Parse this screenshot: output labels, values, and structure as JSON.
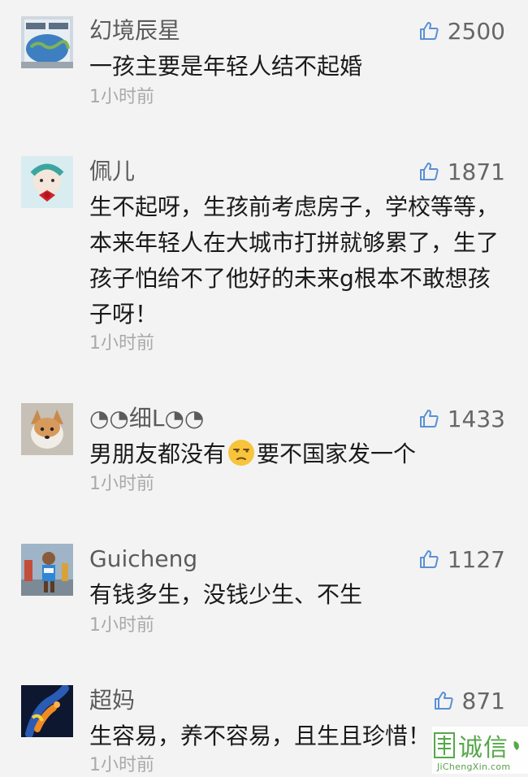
{
  "comments": [
    {
      "username": "幻境辰星",
      "likes": "2500",
      "text": "一孩主要是年轻人结不起婚",
      "time": "1小时前"
    },
    {
      "username": "佩儿",
      "likes": "1871",
      "text": "生不起呀，生孩前考虑房子，学校等等，本来年轻人在大城市打拼就够累了，生了孩子怕给不了他好的未来g根本不敢想孩子呀！",
      "time": "1小时前"
    },
    {
      "username": "◔◔细L◔◔",
      "likes": "1433",
      "text_before": "男朋友都没有",
      "emoji": "unamused-face-emoji",
      "text_after": "要不国家发一个",
      "time": "1小时前"
    },
    {
      "username": "Guicheng",
      "likes": "1127",
      "text": "有钱多生，没钱少生、不生",
      "time": "1小时前"
    },
    {
      "username": "超妈",
      "likes": "871",
      "text": "生容易，养不容易，且生且珍惜！",
      "time": "1小时前"
    }
  ],
  "icons": {
    "like": "thumbs-up-icon"
  },
  "watermark": {
    "chars": "诚信",
    "domain": "JiChengXin.com"
  },
  "colors": {
    "background": "#f3f3f3",
    "username": "#5b5b5b",
    "text": "#1a1a1a",
    "time": "#a9a9a9",
    "thumb": "#5a8fd6",
    "watermark": "#55a84a"
  }
}
